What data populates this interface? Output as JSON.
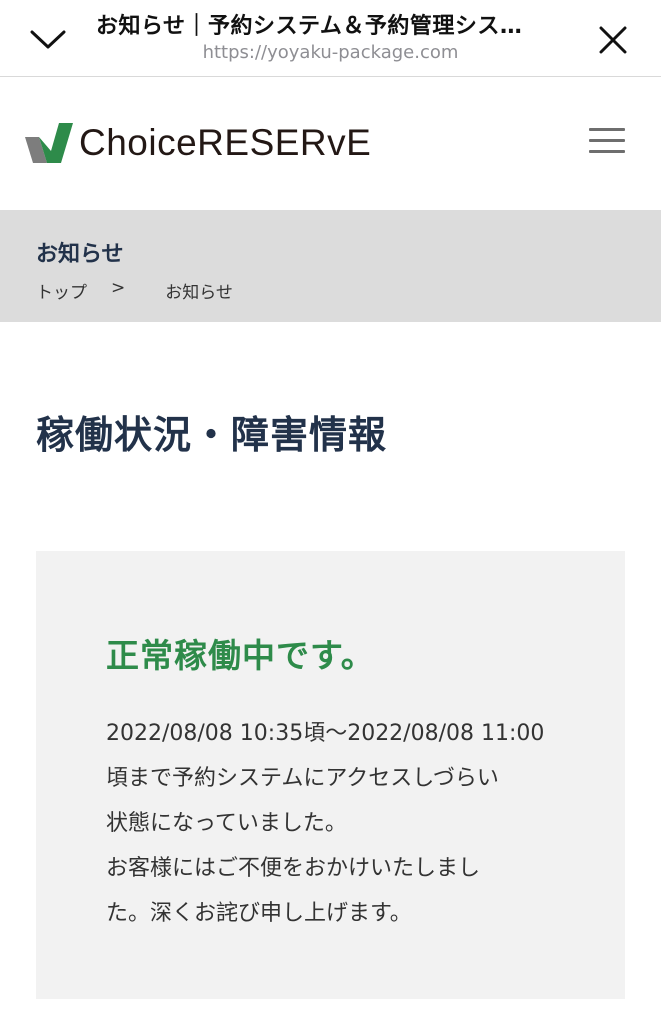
{
  "browser": {
    "tab_title": "お知らせ｜予約システム＆予約管理シス…",
    "url": "https://yoyaku-package.com"
  },
  "header": {
    "logo_text": "ChoiceRESERvE",
    "colors": {
      "logo_green": "#2e8b4a",
      "logo_gray": "#7d7d7d"
    }
  },
  "breadcrumb": {
    "page_title": "お知らせ",
    "items": [
      "トップ",
      ">",
      "お知らせ"
    ]
  },
  "main": {
    "heading": "稼働状況・障害情報",
    "status": {
      "title": "正常稼働中です。",
      "lines": [
        "2022/08/08 10:35頃〜2022/08/08 11:00",
        "頃まで予約システムにアクセスしづらい",
        "状態になっていました。",
        "お客様にはご不便をおかけいたしまし",
        "た。深くお詫び申し上げます。"
      ]
    }
  }
}
